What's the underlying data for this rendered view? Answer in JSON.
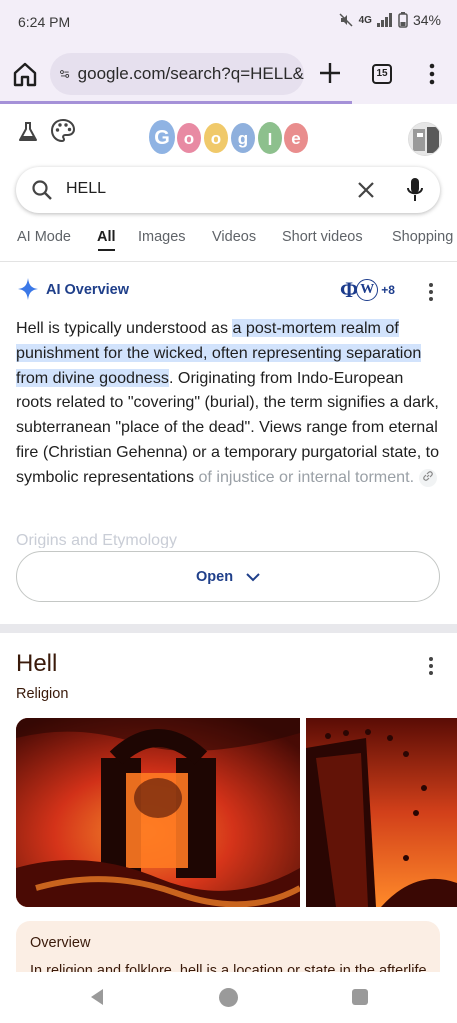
{
  "status_bar": {
    "time": "6:24 PM",
    "network": "4G",
    "battery": "34%"
  },
  "browser": {
    "url": "google.com/search?q=HELL&",
    "tab_count": "15",
    "load_progress": 0.77
  },
  "search": {
    "query": "HELL"
  },
  "tabs": [
    {
      "label": "AI Mode"
    },
    {
      "label": "All"
    },
    {
      "label": "Images"
    },
    {
      "label": "Videos"
    },
    {
      "label": "Short videos"
    },
    {
      "label": "Shopping"
    }
  ],
  "ai_overview": {
    "title": "AI Overview",
    "sources_extra": "+8",
    "text_before": "Hell is typically understood as ",
    "text_highlight": "a post-mortem realm of punishment for the wicked, often representing separation from divine goodness",
    "text_after": ". Originating from Indo-European roots related to \"covering\" (burial), the term signifies a dark, subterranean \"place of the dead\". Views range from eternal fire (Christian Gehenna) or a temporary purgatorial state, to symbolic representations ",
    "text_faded": "of injustice or internal torment.",
    "next_heading": "Origins and Etymology",
    "open_label": "Open"
  },
  "knowledge_panel": {
    "title": "Hell",
    "subtitle": "Religion",
    "overview_title": "Overview",
    "overview_text": "In religion and folklore, hell is a location or state in the afterlife"
  },
  "colors": {
    "accent": "#1f3f8a",
    "highlight": "#d2e3fc",
    "kp_text": "#3a1a0a",
    "overview_bg": "#fbeee4"
  }
}
